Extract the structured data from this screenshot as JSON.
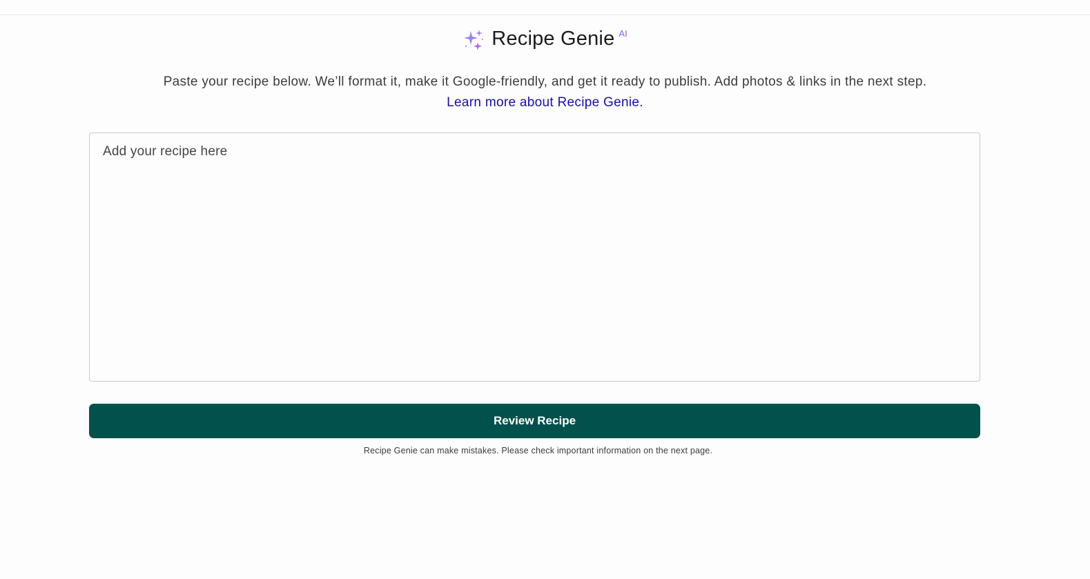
{
  "header": {
    "title": "Recipe Genie",
    "badge": "AI",
    "icon": "sparkles-icon"
  },
  "intro": {
    "description": "Paste your recipe below. We’ll format it, make it Google-friendly, and get it ready to publish. Add photos & links in the next step.",
    "learn_more_link": "Learn more about Recipe Genie."
  },
  "recipe_input": {
    "value": "",
    "placeholder": "Add your recipe here"
  },
  "actions": {
    "review_label": "Review Recipe"
  },
  "footer": {
    "disclaimer": "Recipe Genie can make mistakes. Please check important information on the next page."
  },
  "colors": {
    "primary_button": "#02514c",
    "link": "#1a0dab",
    "ai_badge": "#8b5cf6"
  }
}
